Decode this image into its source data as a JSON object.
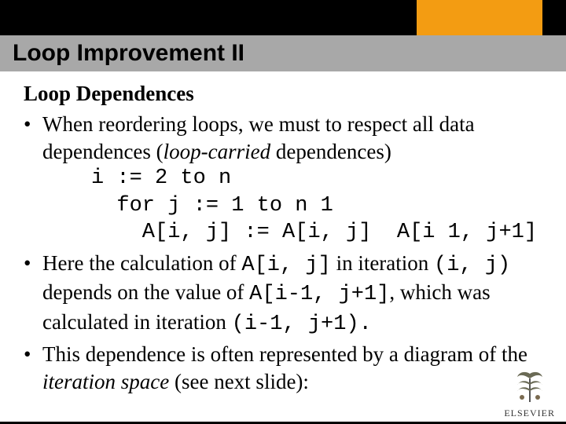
{
  "title": "Loop Improvement II",
  "subhead": "Loop Dependences",
  "bullets": [
    {
      "pre": "When reordering loops, we must to respect all data dependences (",
      "italic": "loop-carried",
      "post": " dependences)"
    },
    {
      "parts": [
        {
          "t": "Here the calculation of ",
          "cls": ""
        },
        {
          "t": "A[i, j]",
          "cls": "mono"
        },
        {
          "t": " in iteration ",
          "cls": ""
        },
        {
          "t": "(i, j)",
          "cls": "mono"
        },
        {
          "t": " depends on the value of ",
          "cls": ""
        },
        {
          "t": "A[i-1, j+1]",
          "cls": "mono"
        },
        {
          "t": ", which was calculated in iteration ",
          "cls": ""
        },
        {
          "t": "(i-1, j+1).",
          "cls": "mono"
        }
      ]
    },
    {
      "pre": "This dependence is often represented by a diagram of the ",
      "italic": "iteration space",
      "post": " (see next slide):"
    }
  ],
  "code": {
    "l1": "i := 2 to n",
    "l2": "  for j := 1 to n 1",
    "l3": "    A[i, j] := A[i, j]  A[i 1, j+1]"
  },
  "logo": {
    "name": "ELSEVIER"
  }
}
